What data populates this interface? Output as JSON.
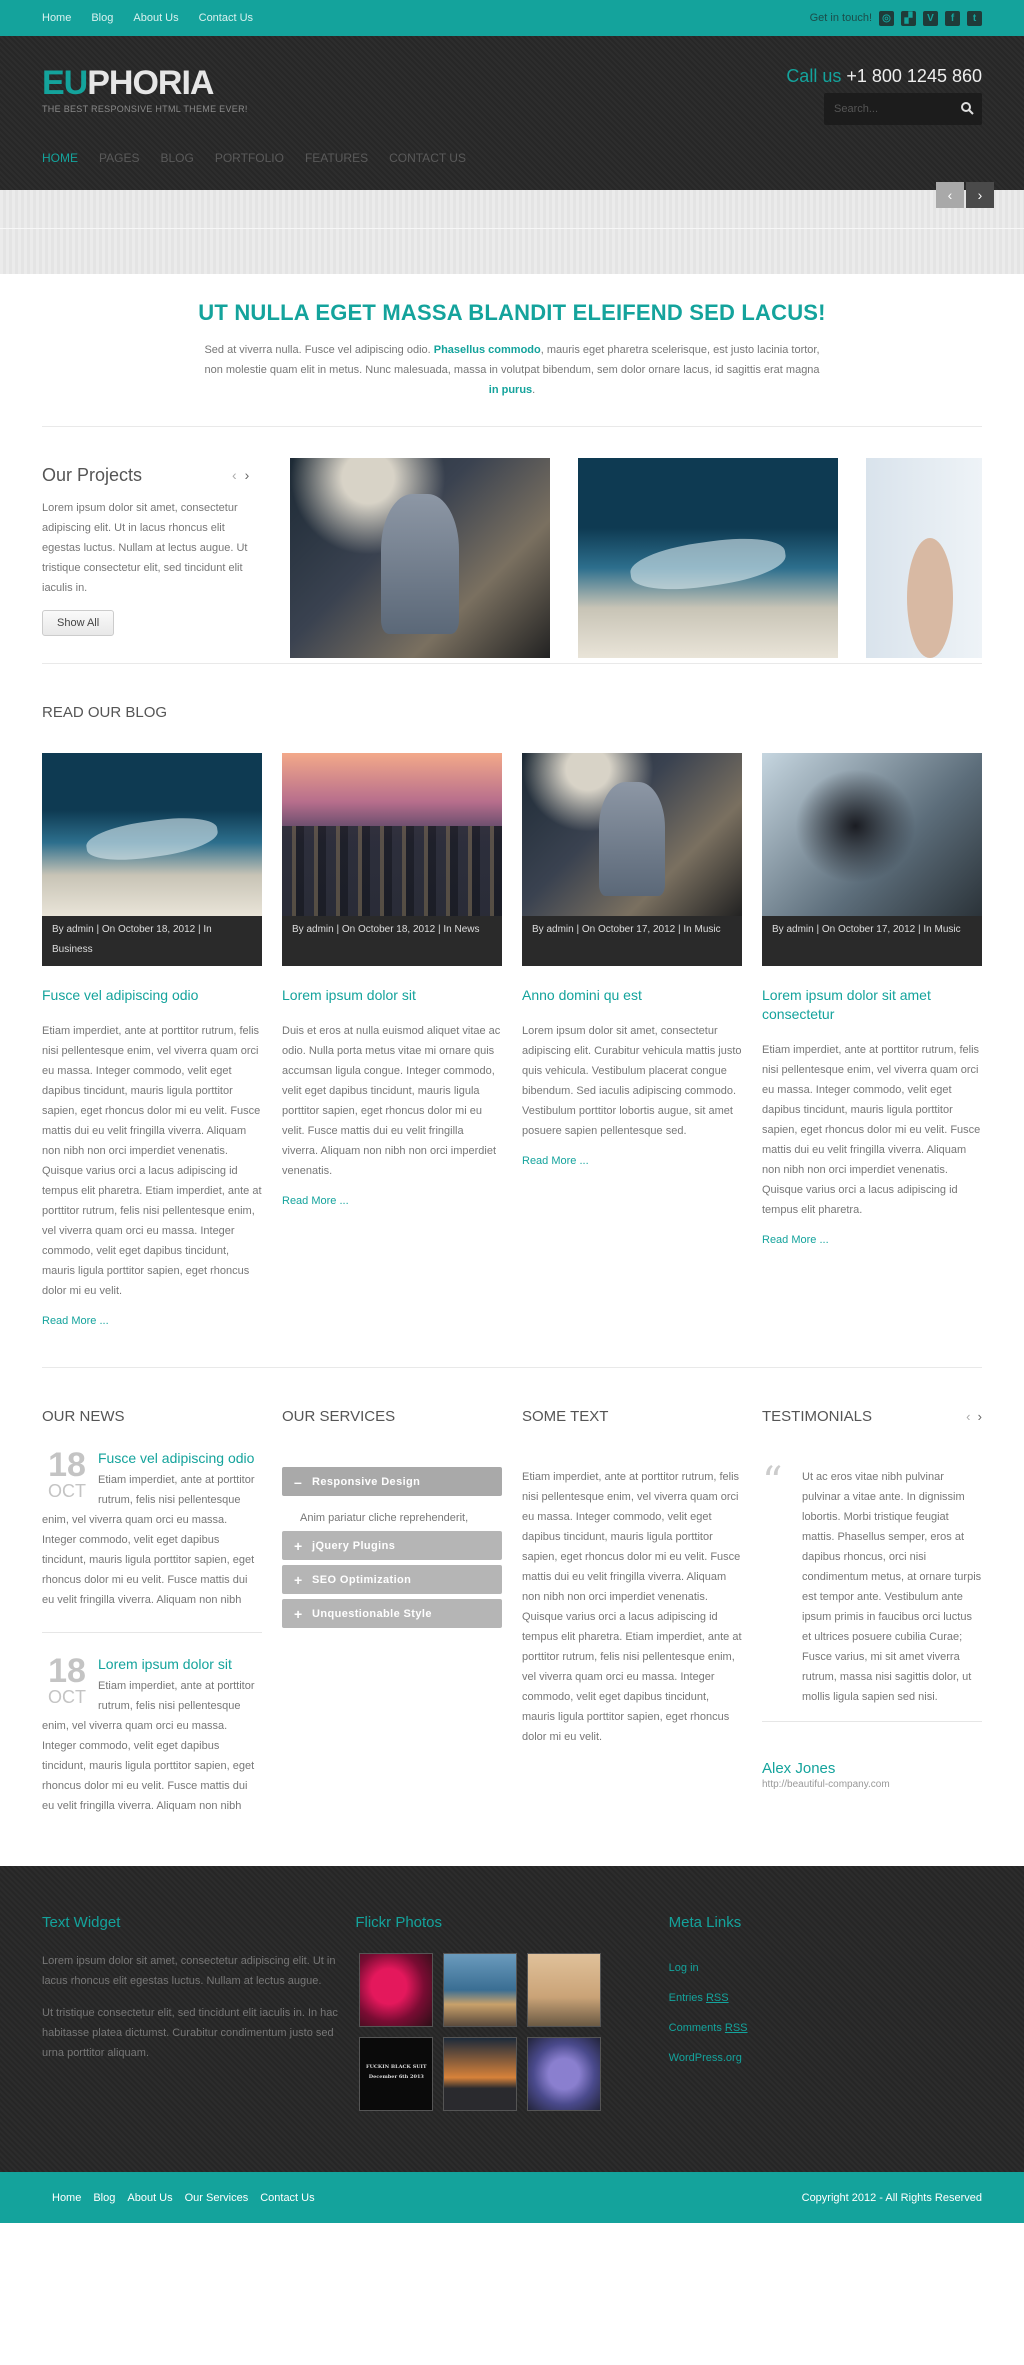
{
  "topbar": {
    "nav": [
      "Home",
      "Blog",
      "About Us",
      "Contact Us"
    ],
    "get_in_touch": "Get in touch!",
    "social_icons": [
      "dribbble-icon",
      "delicious-icon",
      "vimeo-icon",
      "facebook-icon",
      "twitter-icon"
    ]
  },
  "header": {
    "logo_eu": "EU",
    "logo_rest": "PHORIA",
    "tagline": "THE BEST RESPONSIVE HTML THEME EVER!",
    "call_label": "Call us",
    "phone": "+1 800 1245 860",
    "search_placeholder": "Search..."
  },
  "mainnav": [
    "HOME",
    "PAGES",
    "BLOG",
    "PORTFOLIO",
    "FEATURES",
    "CONTACT US"
  ],
  "intro": {
    "title": "UT NULLA EGET MASSA BLANDIT ELEIFEND SED LACUS!",
    "text_a": "Sed at viverra nulla. Fusce vel adipiscing odio.",
    "bold_a": "Phasellus commodo",
    "text_b": ", mauris eget pharetra scelerisque, est justo lacinia tortor, non molestie quam elit in metus. Nunc malesuada, massa in volutpat bibendum, sem dolor ornare lacus, id sagittis erat magna",
    "bold_b": "in purus",
    "text_c": "."
  },
  "projects": {
    "title": "Our Projects",
    "text": "Lorem ipsum dolor sit amet, consectetur adipiscing elit. Ut in lacus rhoncus elit egestas luctus. Nullam at lectus augue. Ut tristique consectetur elit, sed tincidunt elit iaculis in.",
    "button": "Show All"
  },
  "blog": {
    "title": "READ OUR BLOG",
    "posts": [
      {
        "meta": "By admin | On October 18, 2012 | In Business",
        "title": "Fusce vel adipiscing odio",
        "text": "Etiam imperdiet, ante at porttitor rutrum, felis nisi pellentesque enim, vel viverra quam orci eu massa. Integer commodo, velit eget dapibus tincidunt, mauris ligula porttitor sapien, eget rhoncus dolor mi eu velit. Fusce mattis dui eu velit fringilla viverra. Aliquam non nibh non orci imperdiet venenatis. Quisque varius orci a lacus adipiscing id tempus elit pharetra. Etiam imperdiet, ante at porttitor rutrum, felis nisi pellentesque enim, vel viverra quam orci eu massa. Integer commodo, velit eget dapibus tincidunt, mauris ligula porttitor sapien, eget rhoncus dolor mi eu velit.",
        "more": "Read More ..."
      },
      {
        "meta": "By admin | On October 18, 2012 | In News",
        "title": "Lorem ipsum dolor sit",
        "text": "Duis et eros at nulla euismod aliquet vitae ac odio. Nulla porta metus vitae mi ornare quis accumsan ligula congue. Integer commodo, velit eget dapibus tincidunt, mauris ligula porttitor sapien, eget rhoncus dolor mi eu velit. Fusce mattis dui eu velit fringilla viverra. Aliquam non nibh non orci imperdiet venenatis.",
        "more": "Read More ..."
      },
      {
        "meta": "By admin | On October 17, 2012 | In Music",
        "title": "Anno domini qu est",
        "text": "Lorem ipsum dolor sit amet, consectetur adipiscing elit. Curabitur vehicula mattis justo quis vehicula. Vestibulum placerat congue bibendum. Sed iaculis adipiscing commodo. Vestibulum porttitor lobortis augue, sit amet posuere sapien pellentesque sed.",
        "more": "Read More ..."
      },
      {
        "meta": "By admin | On October 17, 2012 | In Music",
        "title": "Lorem ipsum dolor sit amet consectetur",
        "text": "Etiam imperdiet, ante at porttitor rutrum, felis nisi pellentesque enim, vel viverra quam orci eu massa. Integer commodo, velit eget dapibus tincidunt, mauris ligula porttitor sapien, eget rhoncus dolor mi eu velit. Fusce mattis dui eu velit fringilla viverra. Aliquam non nibh non orci imperdiet venenatis. Quisque varius orci a lacus adipiscing id tempus elit pharetra.",
        "more": "Read More ..."
      }
    ]
  },
  "news": {
    "title": "OUR NEWS",
    "items": [
      {
        "day": "18",
        "month": "OCT",
        "title": "Fusce vel adipiscing odio",
        "text": "Etiam imperdiet, ante at porttitor rutrum, felis nisi pellentesque enim, vel viverra quam orci eu massa. Integer commodo, velit eget dapibus tincidunt, mauris ligula porttitor sapien, eget rhoncus dolor mi eu velit. Fusce mattis dui eu velit fringilla viverra. Aliquam non nibh"
      },
      {
        "day": "18",
        "month": "OCT",
        "title": "Lorem ipsum dolor sit",
        "text": "Etiam imperdiet, ante at porttitor rutrum, felis nisi pellentesque enim, vel viverra quam orci eu massa. Integer commodo, velit eget dapibus tincidunt, mauris ligula porttitor sapien, eget rhoncus dolor mi eu velit. Fusce mattis dui eu velit fringilla viverra. Aliquam non nibh"
      }
    ]
  },
  "services": {
    "title": "OUR SERVICES",
    "items": [
      "Responsive Design",
      "jQuery Plugins",
      "SEO Optimization",
      "Unquestionable Style"
    ],
    "open_text": "Anim pariatur cliche reprehenderit, enim eiusmod high life"
  },
  "sometext": {
    "title": "SOME TEXT",
    "text": "Etiam imperdiet, ante at porttitor rutrum, felis nisi pellentesque enim, vel viverra quam orci eu massa. Integer commodo, velit eget dapibus tincidunt, mauris ligula porttitor sapien, eget rhoncus dolor mi eu velit. Fusce mattis dui eu velit fringilla viverra. Aliquam non nibh non orci imperdiet venenatis. Quisque varius orci a lacus adipiscing id tempus elit pharetra. Etiam imperdiet, ante at porttitor rutrum, felis nisi pellentesque enim, vel viverra quam orci eu massa. Integer commodo, velit eget dapibus tincidunt, mauris ligula porttitor sapien, eget rhoncus dolor mi eu velit."
  },
  "testimonials": {
    "title": "TESTIMONIALS",
    "text": "Ut ac eros vitae nibh pulvinar pulvinar a vitae ante. In dignissim lobortis. Morbi tristique feugiat mattis. Phasellus semper, eros at dapibus rhoncus, orci nisi condimentum metus, at ornare turpis est tempor ante. Vestibulum ante ipsum primis in faucibus orci luctus et ultrices posuere cubilia Curae; Fusce varius, mi sit amet viverra rutrum, massa nisi sagittis dolor, ut mollis ligula sapien sed nisi.",
    "author": "Alex Jones",
    "url": "http://beautiful-company.com"
  },
  "footer": {
    "text_widget_title": "Text Widget",
    "text_p1": "Lorem ipsum dolor sit amet, consectetur adipiscing elit. Ut in lacus rhoncus elit egestas luctus. Nullam at lectus augue.",
    "text_p2": "Ut tristique consectetur elit, sed tincidunt elit iaculis in. In hac habitasse platea dictumst. Curabitur condimentum justo sed urna porttitor aliquam.",
    "flickr_title": "Flickr Photos",
    "flickr_caption": "FUCKIN BLACK SUIT",
    "flickr_caption2": "December 6th 2013",
    "meta_title": "Meta Links",
    "meta": {
      "login": "Log in",
      "entries_a": "Entries ",
      "entries_b": "RSS",
      "comments_a": "Comments ",
      "comments_b": "RSS",
      "wp": "WordPress.org"
    }
  },
  "bottombar": {
    "nav": [
      "Home",
      "Blog",
      "About Us",
      "Our Services",
      "Contact Us"
    ],
    "copyright": "Copyright 2012 - All Rights Reserved"
  },
  "colors": {
    "accent": "#14a39c",
    "dark": "#2a2a2a"
  }
}
